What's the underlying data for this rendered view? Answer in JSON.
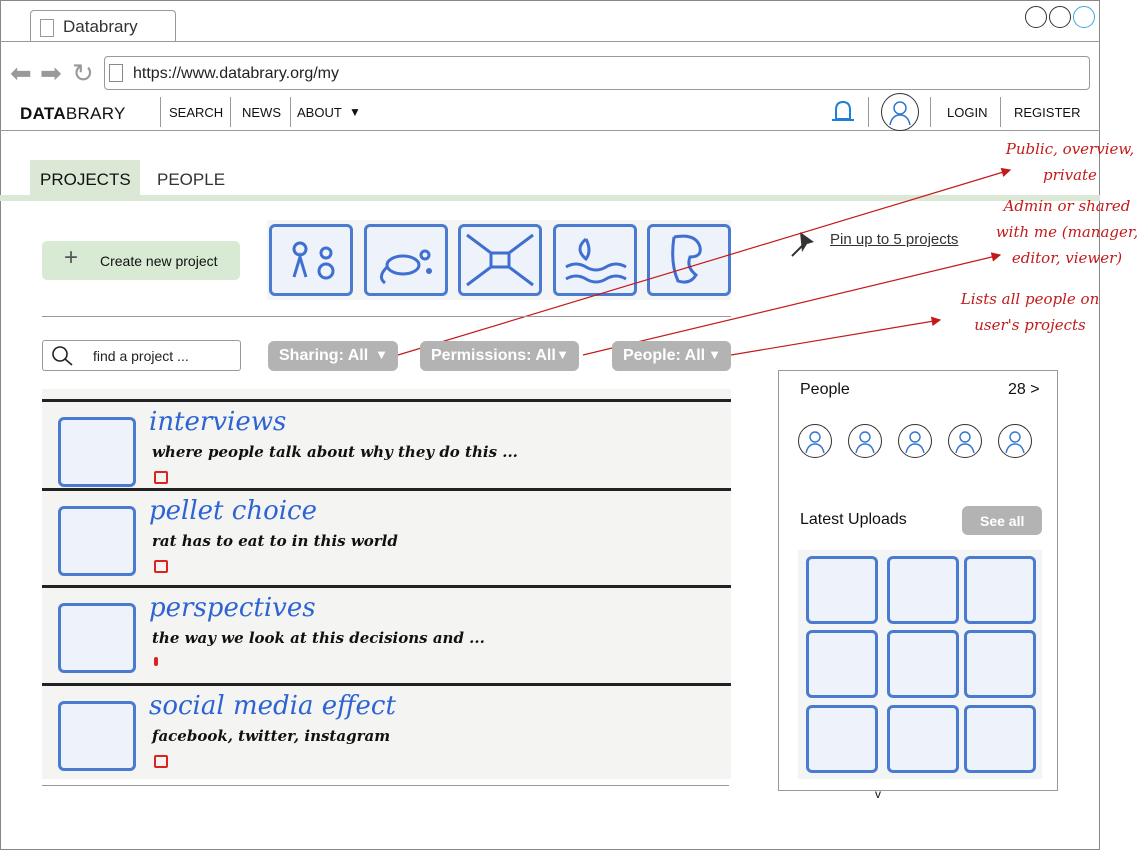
{
  "browser": {
    "tab_title": "Databrary",
    "url": "https://www.databrary.org/my"
  },
  "navbar": {
    "logo_bold": "DATA",
    "logo_rest": "BRARY",
    "links": [
      "SEARCH",
      "NEWS",
      "ABOUT"
    ],
    "about_caret": "▼",
    "login": "LOGIN",
    "register": "REGISTER"
  },
  "page_tabs": {
    "projects": "PROJECTS",
    "people": "PEOPLE"
  },
  "create_button": {
    "icon": "plus-icon",
    "label": "Create new project"
  },
  "pin_note": "Pin up to 5 projects",
  "search": {
    "placeholder": "find a project ..."
  },
  "filters": [
    {
      "label": "Sharing: All",
      "caret": "▼"
    },
    {
      "label": "Permissions: All",
      "caret": "▼"
    },
    {
      "label": "People: All",
      "caret": "▼"
    }
  ],
  "annotations": {
    "sharing": [
      "Public, overview,",
      "private"
    ],
    "permissions": [
      "Admin or shared",
      "with me (manager,",
      "editor, viewer)"
    ],
    "people": [
      "Lists all people on",
      "user's projects"
    ]
  },
  "projects": [
    {
      "title": "interviews",
      "desc": "where people talk about why they do this ..."
    },
    {
      "title": "pellet choice",
      "desc": "rat has to eat to in this world"
    },
    {
      "title": "perspectives",
      "desc": "the way we look at this decisions and ..."
    },
    {
      "title": "social media effect",
      "desc": "facebook, twitter, instagram"
    }
  ],
  "side_panel": {
    "people_title": "People",
    "people_count": "28 >",
    "uploads_title": "Latest Uploads",
    "see_all": "See all",
    "bottom_caret": "v"
  },
  "colors": {
    "accent_green": "#d8ead3",
    "filter_gray": "#b3b3b3",
    "annotation_red": "#c41a1a",
    "sketch_blue": "#4a7bd0"
  }
}
